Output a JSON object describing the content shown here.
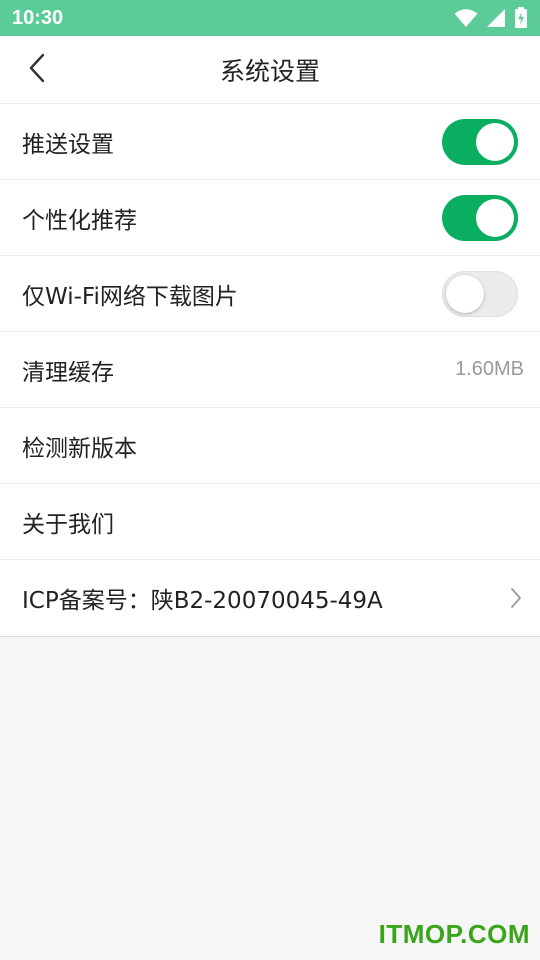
{
  "status_bar": {
    "time": "10:30",
    "icons": [
      "wifi-icon",
      "signal-icon",
      "battery-charging-icon"
    ]
  },
  "nav": {
    "title": "系统设置",
    "back_icon": "chevron-left-icon"
  },
  "settings": {
    "push": {
      "label": "推送设置",
      "enabled": true
    },
    "personalized": {
      "label": "个性化推荐",
      "enabled": true
    },
    "wifi_images": {
      "label": "仅Wi-Fi网络下载图片",
      "enabled": false
    },
    "clear_cache": {
      "label": "清理缓存",
      "value": "1.60MB"
    },
    "check_version": {
      "label": "检测新版本"
    },
    "about": {
      "label": "关于我们"
    },
    "icp": {
      "label": "ICP备案号：陕B2-20070045-49A",
      "icon": "chevron-right-icon"
    }
  },
  "colors": {
    "status_bar": "#5bcc98",
    "toggle_on": "#09ae61",
    "toggle_off": "#ebebeb",
    "background": "#f6f6f6"
  },
  "watermark": "ITMOP.COM"
}
